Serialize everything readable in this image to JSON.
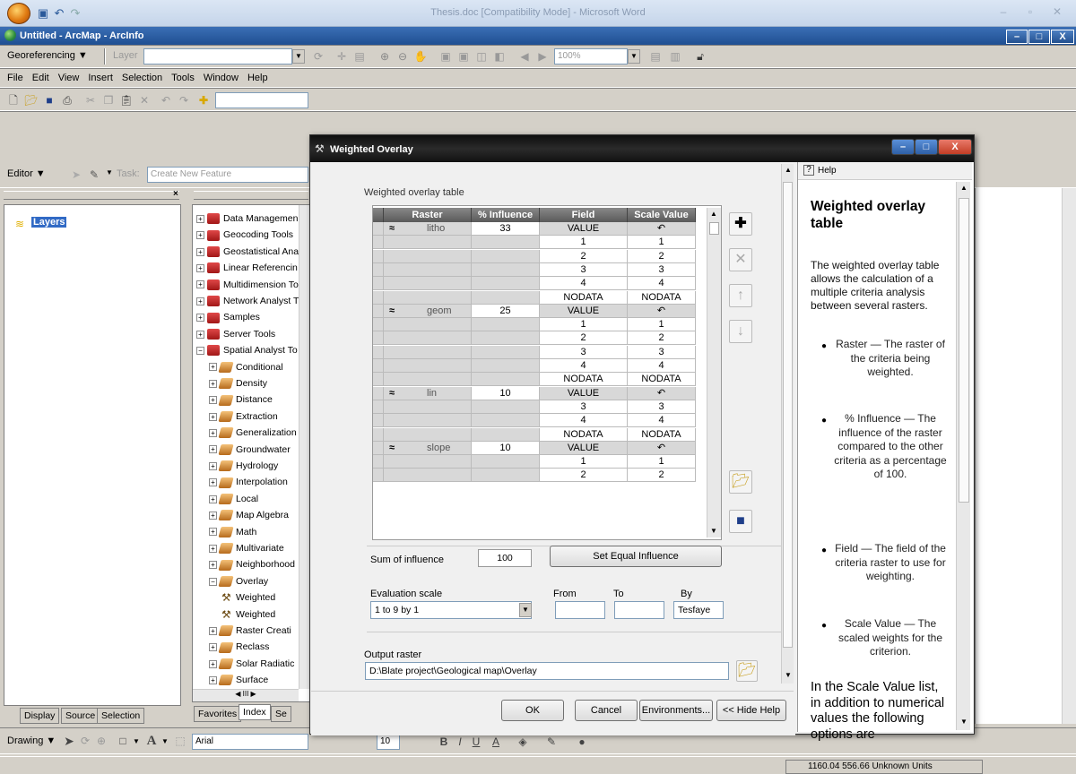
{
  "word": {
    "title": "Thesis.doc [Compatibility Mode] - Microsoft Word"
  },
  "arcmap": {
    "title": "Untitled - ArcMap - ArcInfo",
    "georef": {
      "label": "Georeferencing ▼",
      "layer_label": "Layer",
      "zoom_value": "100%"
    },
    "menu": [
      "File",
      "Edit",
      "View",
      "Insert",
      "Selection",
      "Tools",
      "Window",
      "Help"
    ],
    "editor": {
      "label": "Editor ▼",
      "task_label": "Task:",
      "task_value": "Create New Feature"
    },
    "toc": {
      "layers_label": "Layers",
      "tabs": [
        "Display",
        "Source",
        "Selection"
      ]
    },
    "toolbox": {
      "tabs": [
        "Favorites",
        "Index",
        "Se"
      ],
      "items": [
        {
          "label": "Data Managemen",
          "level": 0,
          "type": "toolbox",
          "pm": "+"
        },
        {
          "label": "Geocoding Tools",
          "level": 0,
          "type": "toolbox",
          "pm": "+"
        },
        {
          "label": "Geostatistical Ana",
          "level": 0,
          "type": "toolbox",
          "pm": "+"
        },
        {
          "label": "Linear Referencin",
          "level": 0,
          "type": "toolbox",
          "pm": "+"
        },
        {
          "label": "Multidimension To",
          "level": 0,
          "type": "toolbox",
          "pm": "+"
        },
        {
          "label": "Network Analyst T",
          "level": 0,
          "type": "toolbox",
          "pm": "+"
        },
        {
          "label": "Samples",
          "level": 0,
          "type": "toolbox",
          "pm": "+"
        },
        {
          "label": "Server Tools",
          "level": 0,
          "type": "toolbox",
          "pm": "+"
        },
        {
          "label": "Spatial Analyst To",
          "level": 0,
          "type": "toolbox",
          "pm": "−"
        },
        {
          "label": "Conditional",
          "level": 1,
          "type": "toolset",
          "pm": "+"
        },
        {
          "label": "Density",
          "level": 1,
          "type": "toolset",
          "pm": "+"
        },
        {
          "label": "Distance",
          "level": 1,
          "type": "toolset",
          "pm": "+"
        },
        {
          "label": "Extraction",
          "level": 1,
          "type": "toolset",
          "pm": "+"
        },
        {
          "label": "Generalization",
          "level": 1,
          "type": "toolset",
          "pm": "+"
        },
        {
          "label": "Groundwater",
          "level": 1,
          "type": "toolset",
          "pm": "+"
        },
        {
          "label": "Hydrology",
          "level": 1,
          "type": "toolset",
          "pm": "+"
        },
        {
          "label": "Interpolation",
          "level": 1,
          "type": "toolset",
          "pm": "+"
        },
        {
          "label": "Local",
          "level": 1,
          "type": "toolset",
          "pm": "+"
        },
        {
          "label": "Map Algebra",
          "level": 1,
          "type": "toolset",
          "pm": "+"
        },
        {
          "label": "Math",
          "level": 1,
          "type": "toolset",
          "pm": "+"
        },
        {
          "label": "Multivariate",
          "level": 1,
          "type": "toolset",
          "pm": "+"
        },
        {
          "label": "Neighborhood",
          "level": 1,
          "type": "toolset",
          "pm": "+"
        },
        {
          "label": "Overlay",
          "level": 1,
          "type": "toolset",
          "pm": "−"
        },
        {
          "label": "Weighted",
          "level": 2,
          "type": "tool",
          "pm": ""
        },
        {
          "label": "Weighted",
          "level": 2,
          "type": "tool",
          "pm": ""
        },
        {
          "label": "Raster Creati",
          "level": 1,
          "type": "toolset",
          "pm": "+"
        },
        {
          "label": "Reclass",
          "level": 1,
          "type": "toolset",
          "pm": "+"
        },
        {
          "label": "Solar Radiatic",
          "level": 1,
          "type": "toolset",
          "pm": "+"
        },
        {
          "label": "Surface",
          "level": 1,
          "type": "toolset",
          "pm": "+"
        }
      ]
    },
    "drawing": {
      "label": "Drawing ▼",
      "font": "Arial",
      "font_size": "10"
    },
    "status": {
      "coords": "1160.04  556.66 Unknown Units"
    }
  },
  "dialog": {
    "title": "Weighted Overlay",
    "table_label": "Weighted overlay table",
    "columns": [
      "Raster",
      "% Influence",
      "Field",
      "Scale Value"
    ],
    "rows": [
      {
        "kind": "raster",
        "raster": "litho",
        "influence": "33",
        "field": "VALUE",
        "scale": "↶"
      },
      {
        "kind": "value",
        "field": "1",
        "scale": "1"
      },
      {
        "kind": "value",
        "field": "2",
        "scale": "2"
      },
      {
        "kind": "value",
        "field": "3",
        "scale": "3"
      },
      {
        "kind": "value",
        "field": "4",
        "scale": "4"
      },
      {
        "kind": "value",
        "field": "NODATA",
        "scale": "NODATA"
      },
      {
        "kind": "raster",
        "raster": "geom",
        "influence": "25",
        "field": "VALUE",
        "scale": "↶"
      },
      {
        "kind": "value",
        "field": "1",
        "scale": "1"
      },
      {
        "kind": "value",
        "field": "2",
        "scale": "2"
      },
      {
        "kind": "value",
        "field": "3",
        "scale": "3"
      },
      {
        "kind": "value",
        "field": "4",
        "scale": "4"
      },
      {
        "kind": "value",
        "field": "NODATA",
        "scale": "NODATA"
      },
      {
        "kind": "raster",
        "raster": "lin",
        "influence": "10",
        "field": "VALUE",
        "scale": "↶"
      },
      {
        "kind": "value",
        "field": "3",
        "scale": "3"
      },
      {
        "kind": "value",
        "field": "4",
        "scale": "4"
      },
      {
        "kind": "value",
        "field": "NODATA",
        "scale": "NODATA"
      },
      {
        "kind": "raster",
        "raster": "slope",
        "influence": "10",
        "field": "VALUE",
        "scale": "↶"
      },
      {
        "kind": "value",
        "field": "1",
        "scale": "1"
      },
      {
        "kind": "value",
        "field": "2",
        "scale": "2"
      }
    ],
    "sum_label": "Sum of influence",
    "sum_value": "100",
    "equal_btn": "Set Equal Influence",
    "eval_label": "Evaluation scale",
    "eval_value": "1 to 9 by 1",
    "from_label": "From",
    "to_label": "To",
    "by_label": "By",
    "from_value": "",
    "to_value": "",
    "by_value": "Tesfaye",
    "output_label": "Output raster",
    "output_value": "D:\\Blate project\\Geological map\\Overlay",
    "ok": "OK",
    "cancel": "Cancel",
    "env": "Environments...",
    "hide": "<< Hide Help"
  },
  "help": {
    "tab": "Help",
    "title": "Weighted overlay table",
    "intro": "The weighted overlay table allows the calculation of a multiple criteria analysis between several rasters.",
    "bullets": [
      "Raster — The raster of the criteria being weighted.",
      "% Influence — The influence of the raster compared to the other criteria as a percentage of 100.",
      "Field — The field of the criteria raster to use for weighting.",
      "Scale Value — The scaled weights for the criterion."
    ],
    "tail": "In the Scale Value list, in addition to numerical values the following options are"
  }
}
